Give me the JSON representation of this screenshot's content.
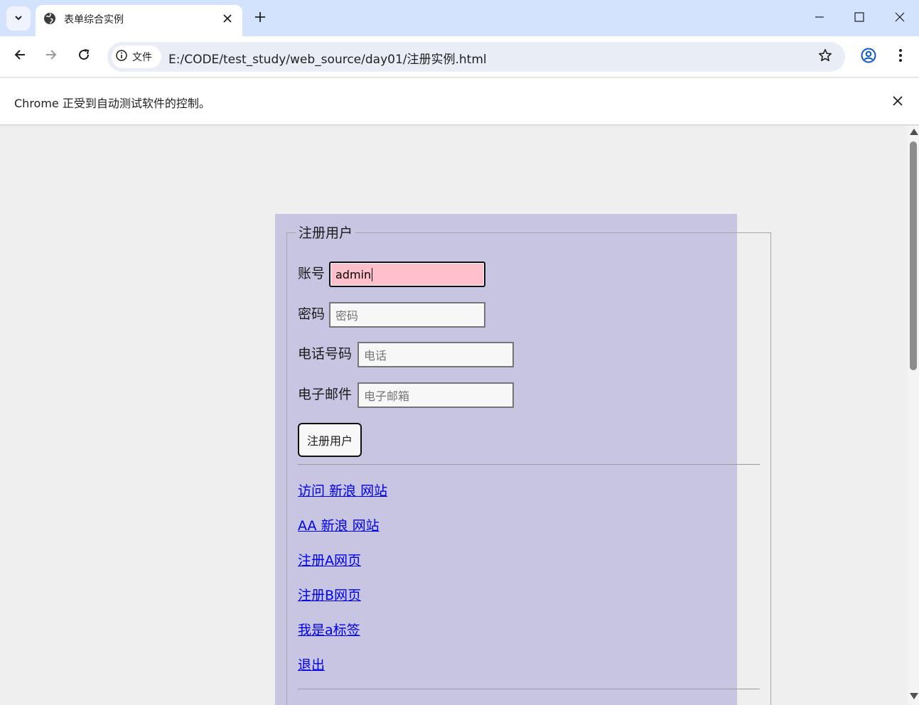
{
  "tab": {
    "title": "表单综合实例"
  },
  "address_bar": {
    "site_chip_label": "文件",
    "url": "E:/CODE/test_study/web_source/day01/注册实例.html"
  },
  "infobar": {
    "message": "Chrome 正受到自动测试软件的控制。"
  },
  "form": {
    "legend": "注册用户",
    "account": {
      "label": "账号",
      "value": "admin"
    },
    "password": {
      "label": "密码",
      "placeholder": "密码"
    },
    "phone": {
      "label": "电话号码",
      "placeholder": "电话"
    },
    "email": {
      "label": "电子邮件",
      "placeholder": "电子邮箱"
    },
    "submit_label": "注册用户"
  },
  "links": [
    "访问 新浪 网站",
    "AA 新浪 网站",
    "注册A网页",
    "注册B网页",
    "我是a标签",
    "退出"
  ],
  "colors": {
    "page_background": "#c7c5e1",
    "active_input": "#ffc0cb",
    "link": "#0000ee",
    "tabstrip": "#d3e3fd"
  }
}
